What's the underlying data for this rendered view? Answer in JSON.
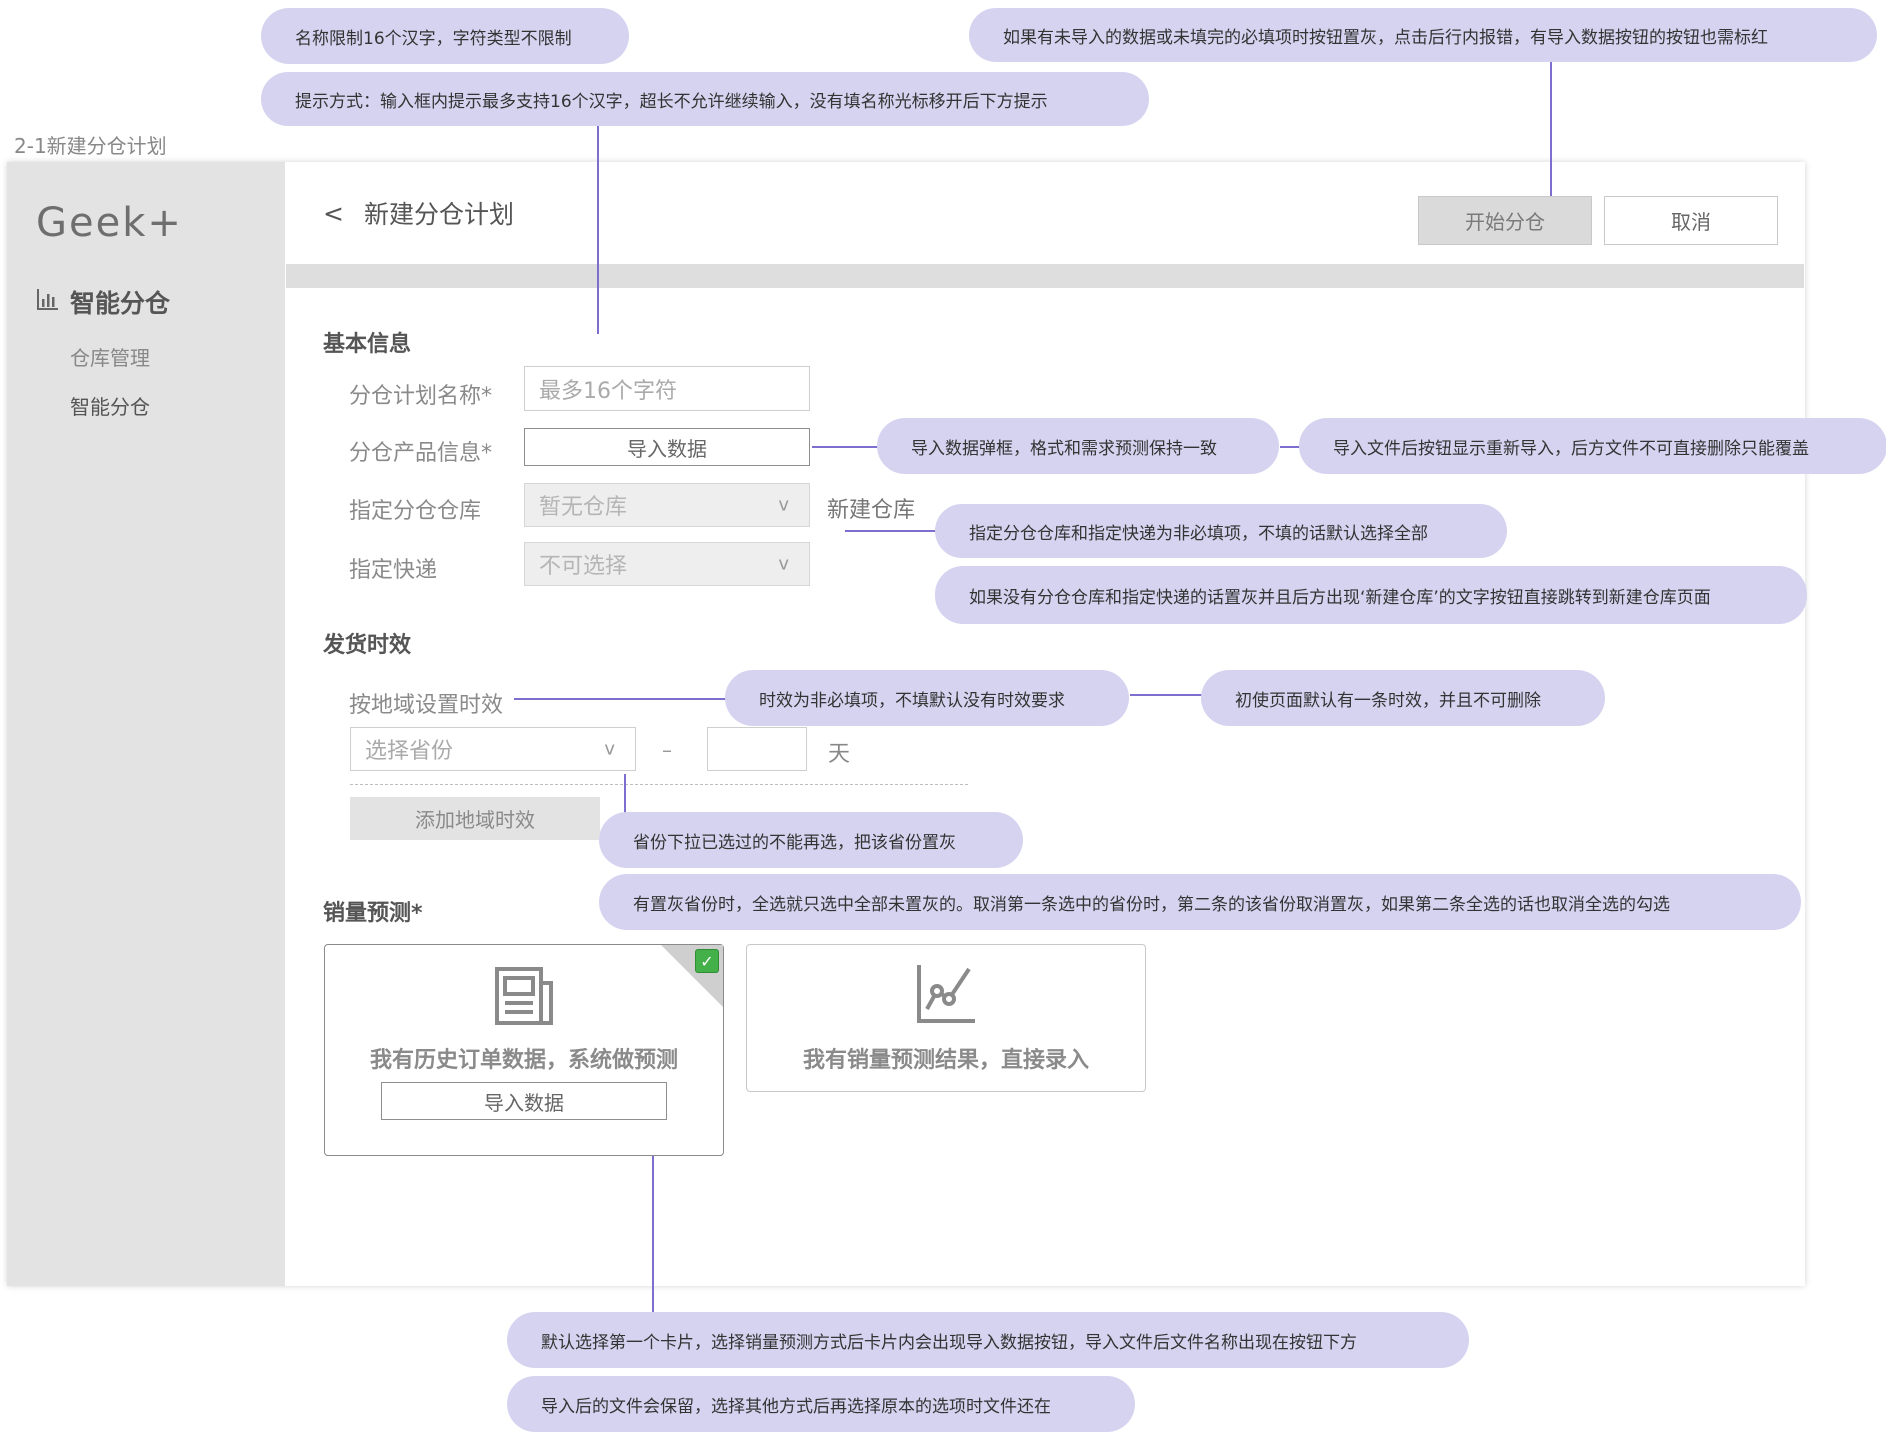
{
  "frame": {
    "caption": "2-1新建分仓计划"
  },
  "sidebar": {
    "logo": "Geek+",
    "main_item": "智能分仓",
    "sub_items": [
      "仓库管理",
      "智能分仓"
    ]
  },
  "header": {
    "back_symbol": "<",
    "title": "新建分仓计划",
    "start_button": "开始分仓",
    "cancel_button": "取消"
  },
  "basic_info": {
    "title": "基本信息",
    "plan_name": {
      "label": "分仓计划名称*",
      "placeholder": "最多16个字符"
    },
    "product_info": {
      "label": "分仓产品信息*",
      "button": "导入数据"
    },
    "warehouse": {
      "label": "指定分仓仓库",
      "value": "暂无仓库",
      "link": "新建仓库"
    },
    "express": {
      "label": "指定快递",
      "value": "不可选择"
    }
  },
  "delivery": {
    "title": "发货时效",
    "region_label": "按地域设置时效",
    "province_placeholder": "选择省份",
    "dash": "–",
    "unit": "天",
    "add_button": "添加地域时效"
  },
  "forecast": {
    "title": "销量预测*",
    "card1": {
      "text": "我有历史订单数据，系统做预测",
      "button": "导入数据",
      "selected": true
    },
    "card2": {
      "text": "我有销量预测结果，直接录入"
    }
  },
  "chev": "v",
  "check_mark": "✓",
  "annotations": {
    "n1": "名称限制16个汉字，字符类型不限制",
    "n2": "提示方式：输入框内提示最多支持16个汉字，超长不允许继续输入，没有填名称光标移开后下方提示",
    "n3": "如果有未导入的数据或未填完的必填项时按钮置灰，点击后行内报错，有导入数据按钮的按钮也需标红",
    "n4": "导入数据弹框，格式和需求预测保持一致",
    "n5": "导入文件后按钮显示重新导入，后方文件不可直接删除只能覆盖",
    "n6": "指定分仓仓库和指定快递为非必填项，不填的话默认选择全部",
    "n7": "如果没有分仓仓库和指定快递的话置灰并且后方出现‘新建仓库’的文字按钮直接跳转到新建仓库页面",
    "n8": "时效为非必填项，不填默认没有时效要求",
    "n9": "初使页面默认有一条时效，并且不可删除",
    "n10": "省份下拉已选过的不能再选，把该省份置灰",
    "n11": "有置灰省份时，全选就只选中全部未置灰的。取消第一条选中的省份时，第二条的该省份取消置灰，如果第二条全选的话也取消全选的勾选",
    "n12": "默认选择第一个卡片，选择销量预测方式后卡片内会出现导入数据按钮，导入文件后文件名称出现在按钮下方",
    "n13": "导入后的文件会保留，选择其他方式后再选择原本的选项时文件还在"
  }
}
